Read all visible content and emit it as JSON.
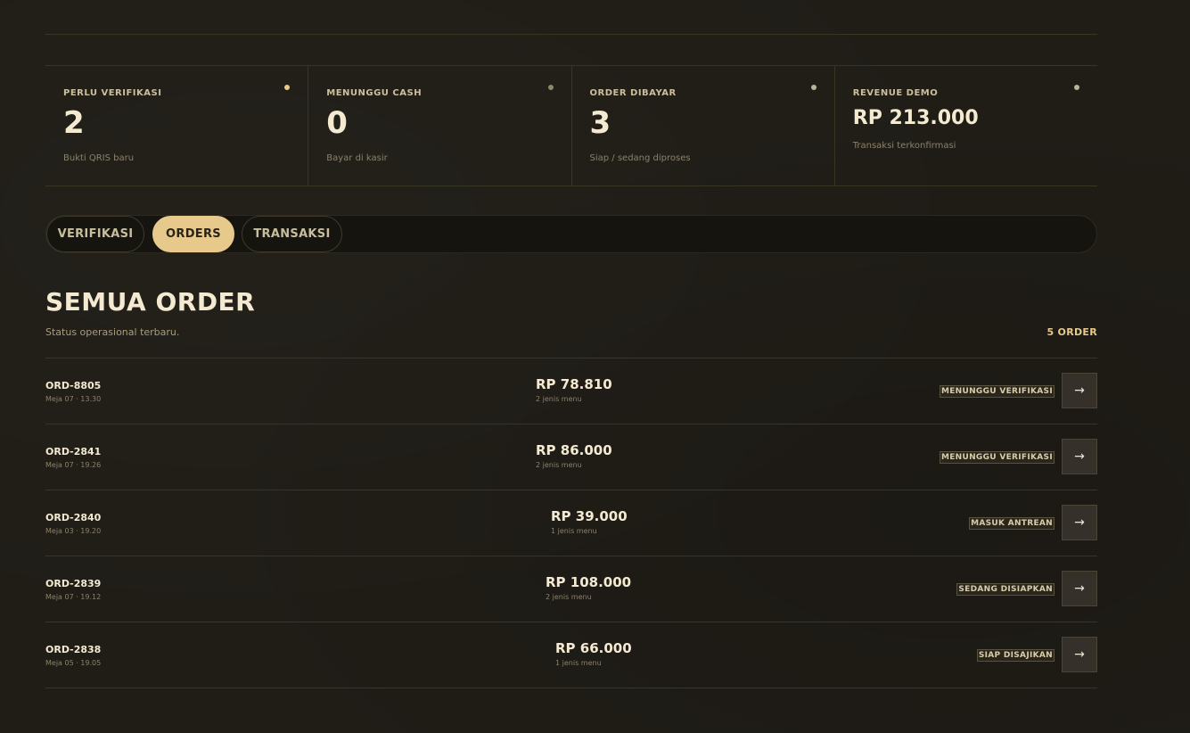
{
  "stats": [
    {
      "label": "PERLU VERIFIKASI",
      "value": "2",
      "sub": "Bukti QRIS baru",
      "dot": "#e8c98c"
    },
    {
      "label": "MENUNGGU CASH",
      "value": "0",
      "sub": "Bayar di kasir",
      "dot": "#8a8a6a"
    },
    {
      "label": "ORDER DIBAYAR",
      "value": "3",
      "sub": "Siap / sedang diproses",
      "dot": "#b7b49c"
    },
    {
      "label": "REVENUE DEMO",
      "value": "RP 213.000",
      "sub": "Transaksi terkonfirmasi",
      "dot": "#b7b49c"
    }
  ],
  "tabs": [
    {
      "label": "VERIFIKASI",
      "active": false
    },
    {
      "label": "ORDERS",
      "active": true
    },
    {
      "label": "TRANSAKSI",
      "active": false
    }
  ],
  "section": {
    "title": "SEMUA ORDER",
    "subtitle": "Status operasional terbaru.",
    "count": "5 ORDER"
  },
  "orders": [
    {
      "id": "ORD-8805",
      "meta": "Meja 07 · 13.30",
      "price": "RP 78.810",
      "items": "2 jenis menu",
      "status": "MENUNGGU VERIFIKASI"
    },
    {
      "id": "ORD-2841",
      "meta": "Meja 07 · 19.26",
      "price": "RP 86.000",
      "items": "2 jenis menu",
      "status": "MENUNGGU VERIFIKASI"
    },
    {
      "id": "ORD-2840",
      "meta": "Meja 03 · 19.20",
      "price": "RP 39.000",
      "items": "1 jenis menu",
      "status": "MASUK ANTREAN"
    },
    {
      "id": "ORD-2839",
      "meta": "Meja 07 · 19.12",
      "price": "RP 108.000",
      "items": "2 jenis menu",
      "status": "SEDANG DISIAPKAN"
    },
    {
      "id": "ORD-2838",
      "meta": "Meja 05 · 19.05",
      "price": "RP 66.000",
      "items": "1 jenis menu",
      "status": "SIAP DISAJIKAN"
    }
  ],
  "icons": {
    "row_action": "arrow-right-icon",
    "arrow_glyph": "→"
  },
  "colors": {
    "accent": "#e8c98c",
    "background": "#201d17"
  }
}
